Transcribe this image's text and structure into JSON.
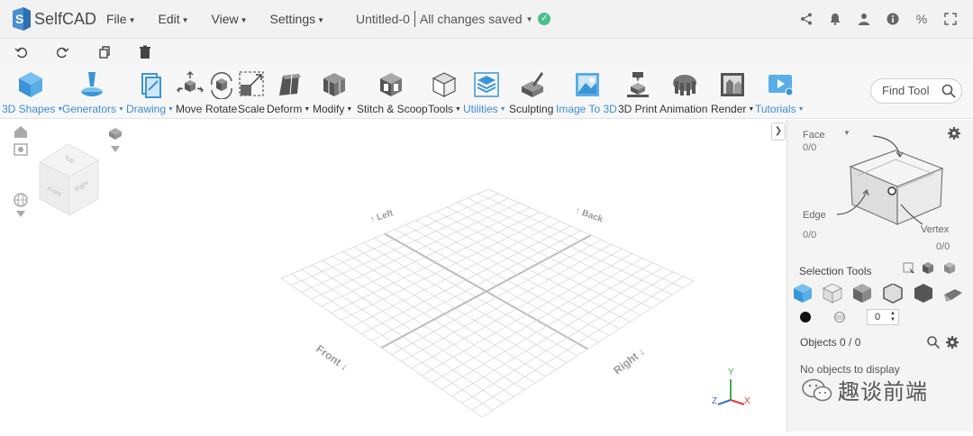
{
  "app": {
    "name": "SelfCAD"
  },
  "menu": [
    {
      "label": "File"
    },
    {
      "label": "Edit"
    },
    {
      "label": "View"
    },
    {
      "label": "Settings"
    }
  ],
  "document": {
    "title": "Untitled-0",
    "status": "All changes saved"
  },
  "top_icons": [
    "share-icon",
    "bell-icon",
    "user-icon",
    "info-icon",
    "percent-icon",
    "fullscreen-icon"
  ],
  "edit_bar": [
    "undo-icon",
    "redo-icon",
    "copy-icon",
    "delete-icon"
  ],
  "toolbar": {
    "tools": [
      {
        "label": "3D Shapes",
        "dropdown": true,
        "blue": true
      },
      {
        "label": "Generators",
        "dropdown": true,
        "blue": true
      },
      {
        "label": "Drawing",
        "dropdown": true,
        "blue": true
      },
      {
        "label": "Move",
        "dropdown": false,
        "blue": false
      },
      {
        "label": "Rotate",
        "dropdown": false,
        "blue": false
      },
      {
        "label": "Scale",
        "dropdown": false,
        "blue": false
      },
      {
        "label": "Deform",
        "dropdown": true,
        "blue": false
      },
      {
        "label": "Modify",
        "dropdown": true,
        "blue": false
      },
      {
        "label": "Stitch & Scoop",
        "dropdown": false,
        "blue": false
      },
      {
        "label": "Tools",
        "dropdown": true,
        "blue": false
      },
      {
        "label": "Utilities",
        "dropdown": true,
        "blue": true
      },
      {
        "label": "Sculpting",
        "dropdown": false,
        "blue": false
      },
      {
        "label": "Image To 3D",
        "dropdown": false,
        "blue": true
      },
      {
        "label": "3D Print",
        "dropdown": false,
        "blue": false
      },
      {
        "label": "Animation",
        "dropdown": false,
        "blue": false
      },
      {
        "label": "Render",
        "dropdown": true,
        "blue": false
      },
      {
        "label": "Tutorials",
        "dropdown": true,
        "blue": true
      }
    ],
    "find_tool": "Find Tool"
  },
  "viewport": {
    "grid_labels": [
      "Left",
      "Back",
      "Front",
      "Right"
    ],
    "view_cube": {
      "faces": [
        "Top",
        "Front",
        "Right"
      ]
    },
    "axes": [
      "X",
      "Y",
      "Z"
    ]
  },
  "right_panel": {
    "face": {
      "label": "Face",
      "count": "0/0"
    },
    "edge": {
      "label": "Edge",
      "count": "0/0"
    },
    "vertex": {
      "label": "Vertex",
      "count": "0/0"
    },
    "selection_tools": "Selection Tools",
    "stepper_value": "0",
    "objects": {
      "label": "Objects 0 / 0",
      "empty": "No objects to display"
    }
  },
  "watermark": "趣谈前端",
  "colors": {
    "accent": "#3c8dd6",
    "saved": "#4cbf8f",
    "toolbar_bg": "#f7f7f7",
    "panel_bg": "#f4f4f4"
  }
}
